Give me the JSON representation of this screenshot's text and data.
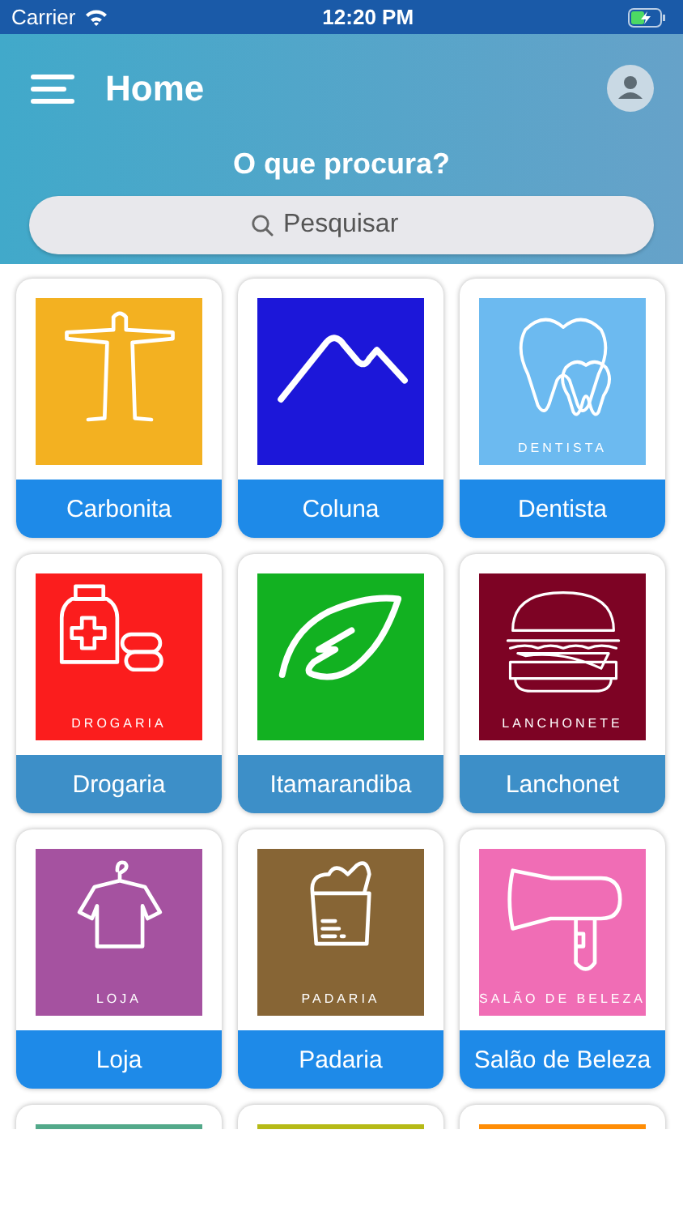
{
  "status_bar": {
    "carrier": "Carrier",
    "time": "12:20 PM"
  },
  "header": {
    "title": "Home",
    "question": "O que procura?"
  },
  "search": {
    "placeholder": "Pesquisar"
  },
  "tiles": [
    {
      "label": {
        "text": "Carbonita",
        "color": "#1e8ae8"
      },
      "color": "#f3b121"
    },
    {
      "label": {
        "text": "Coluna",
        "color": "#1e8ae8"
      },
      "color": "#1c17d9"
    },
    {
      "label": {
        "text": "Dentista",
        "color": "#1e8ae8"
      },
      "caption": "DENTISTA",
      "color": "#6cbaf0"
    },
    {
      "label": {
        "text": "Drogaria",
        "color": "#3d8fc8"
      },
      "caption": "DROGARIA",
      "color": "#fb1d1d"
    },
    {
      "label": {
        "text": "Itamarandiba",
        "color": "#3d8fc8"
      },
      "color": "#12b121"
    },
    {
      "label": {
        "text": "Lanchonet",
        "color": "#3d8fc8"
      },
      "caption": "LANCHONETE",
      "color": "#7d0324"
    },
    {
      "label": {
        "text": "Loja",
        "color": "#1e8ae8"
      },
      "caption": "LOJA",
      "color": "#a552a0"
    },
    {
      "label": {
        "text": "Padaria",
        "color": "#1e8ae8"
      },
      "caption": "PADARIA",
      "color": "#876535"
    },
    {
      "label": {
        "text": "Salão de Beleza",
        "color": "#1e8ae8"
      },
      "caption": "SALÃO DE BELEZA",
      "color": "#f06db5"
    },
    {
      "color": "#53a98a"
    },
    {
      "color": "#b6ba17"
    },
    {
      "color": "#ff8d05"
    }
  ]
}
